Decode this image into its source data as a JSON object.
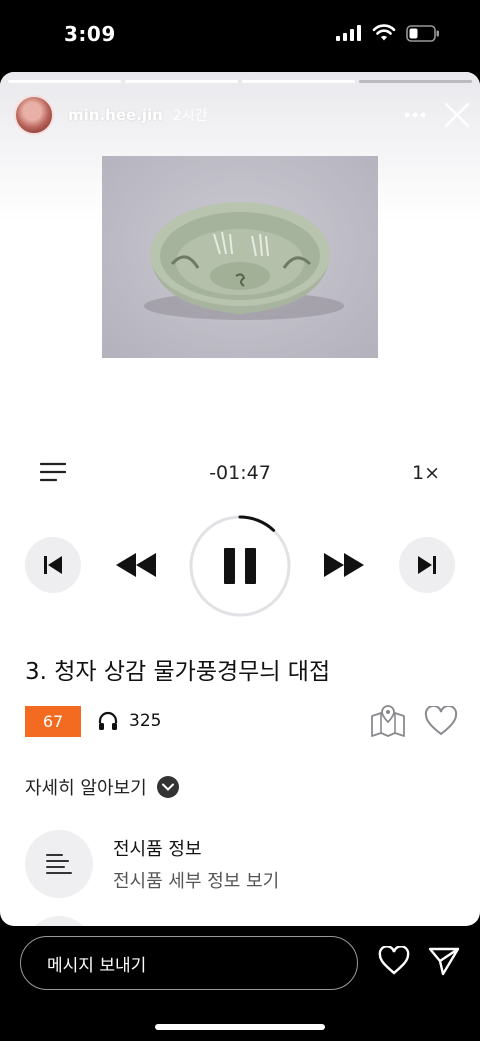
{
  "status_bar": {
    "time": "3:09",
    "icons": [
      "cellular-signal-icon",
      "wifi-icon",
      "battery-icon"
    ]
  },
  "story": {
    "username": "min.hee.jin",
    "time_ago": "2시간",
    "progress_segments": 4,
    "header_icons": [
      "more-icon",
      "close-icon"
    ]
  },
  "player": {
    "remaining_time": "-01:47",
    "speed": "1×",
    "playback_state": "playing",
    "progress_fraction": 0.12,
    "track_title": "3. 청자 상감 물가풍경무늬 대접",
    "track_number_badge": "67",
    "listen_count": "325"
  },
  "details": {
    "toggle_label": "자세히 알아보기",
    "items": [
      {
        "title": "전시품 정보",
        "subtitle": "전시품 세부 정보 보기"
      }
    ]
  },
  "reply": {
    "placeholder": "메시지 보내기"
  },
  "colors": {
    "accent": "#f26b21",
    "story_bg": "#ffffff",
    "button_bg": "#eeeef1"
  }
}
